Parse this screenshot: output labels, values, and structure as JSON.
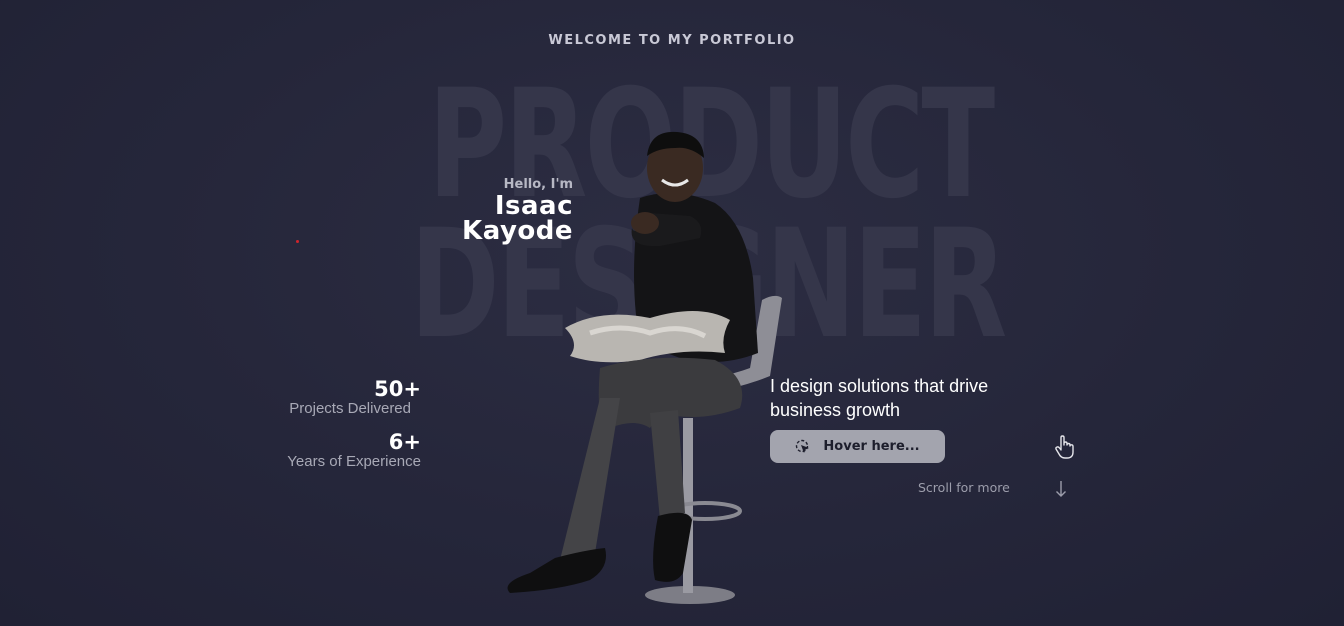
{
  "header": {
    "welcome": "WELCOME TO MY PORTFOLIO"
  },
  "background": {
    "word1": "PRODUCT",
    "word2": "DESIGNER"
  },
  "intro": {
    "greeting": "Hello, I'm",
    "first_name": "Isaac",
    "last_name": "Kayode"
  },
  "stats": [
    {
      "value": "50+",
      "label": "Projects Delivered"
    },
    {
      "value": "6+",
      "label": "Years of Experience"
    }
  ],
  "tagline": "I design solutions that drive business growth",
  "cta": {
    "label": "Hover here...",
    "icon": "cursor-click-icon"
  },
  "scroll": {
    "label": "Scroll for more",
    "icon": "arrow-down-icon"
  },
  "icons": {
    "hand": "hand-pointer-icon"
  },
  "colors": {
    "background": "#25263a",
    "button": "#a3a4ae",
    "accent_dot": "#d0242b"
  }
}
